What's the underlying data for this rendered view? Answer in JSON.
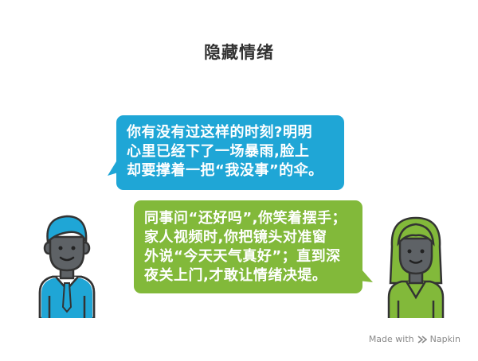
{
  "title": "隐藏情绪",
  "bubbles": {
    "blue": {
      "color": "#1fa6d6",
      "lines": [
        "你有没有过这样的时刻?明明",
        "心里已经下了一场暴雨,脸上",
        "却要撑着一把“我没事”的伞。"
      ]
    },
    "green": {
      "color": "#82b93a",
      "lines": [
        "同事问“还好吗”,你笑着摆手；",
        "家人视频时,你把镜头对准窗",
        "外说“今天天气真好”；直到深",
        "夜关上门,才敢让情绪决堤。"
      ]
    }
  },
  "avatars": {
    "man": {
      "icon": "man-avatar-icon",
      "color": "#1fa6d6"
    },
    "woman": {
      "icon": "woman-avatar-icon",
      "color": "#82b93a"
    }
  },
  "watermark": {
    "made_with": "Made with",
    "brand": "Napkin"
  }
}
